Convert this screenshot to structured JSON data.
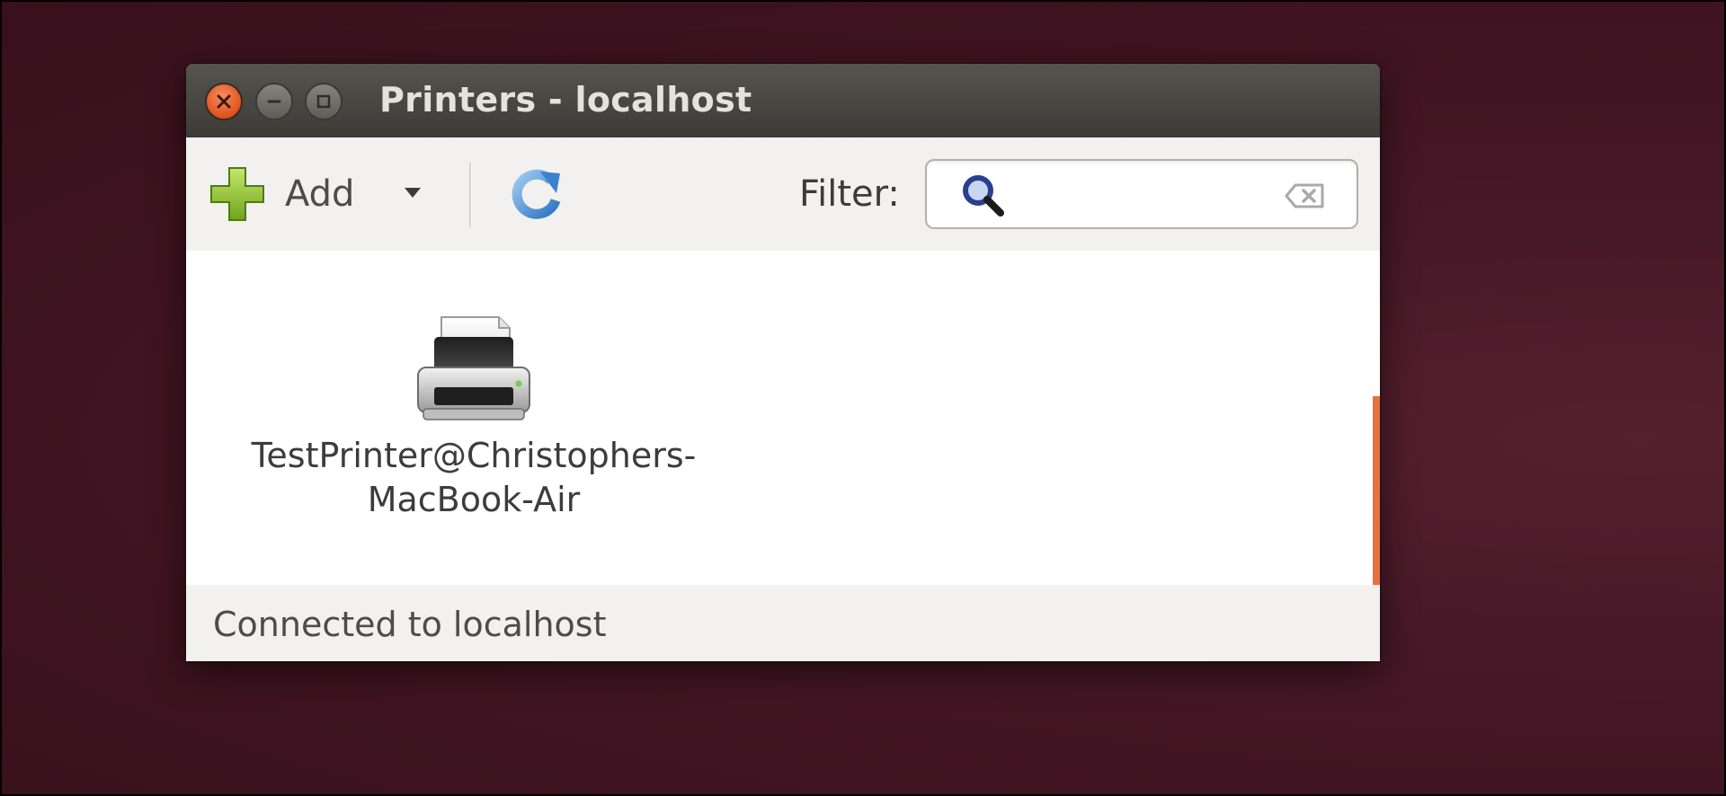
{
  "window": {
    "title": "Printers - localhost"
  },
  "toolbar": {
    "add_label": "Add",
    "add_icon": "plus-icon",
    "refresh_icon": "refresh-icon",
    "filter_label": "Filter:",
    "filter_value": "",
    "filter_placeholder": ""
  },
  "printers": [
    {
      "name_line1": "TestPrinter@Christophers-",
      "name_line2": "MacBook-Air",
      "icon": "printer-icon"
    }
  ],
  "status": {
    "text": "Connected to localhost"
  },
  "colors": {
    "desktop": "#471828",
    "titlebar": "#3c3b37",
    "close_button": "#e0531a",
    "scroll_indicator": "#e9703d"
  }
}
